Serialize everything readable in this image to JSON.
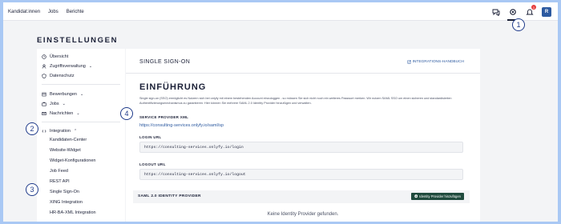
{
  "topnav": {
    "items": [
      "Kandidat:innen",
      "Jobs",
      "Berichte"
    ]
  },
  "topicons": {
    "badge": "1",
    "avatar": "R"
  },
  "page_title": "EINSTELLUNGEN",
  "sidebar": {
    "items": [
      {
        "label": "Übersicht",
        "icon": "clock-icon"
      },
      {
        "label": "Zugriffsverwaltung",
        "icon": "person-icon",
        "chevron": "⌄"
      },
      {
        "label": "Datenschutz",
        "icon": "shield-icon"
      },
      {
        "label": "Bewerbungen",
        "icon": "folder-icon",
        "chevron": "⌄"
      },
      {
        "label": "Jobs",
        "icon": "briefcase-icon",
        "chevron": "⌄"
      },
      {
        "label": "Nachrichten",
        "icon": "mail-icon",
        "chevron": "⌄"
      },
      {
        "label": "Integration",
        "icon": "code-icon",
        "chevron": "⌃"
      }
    ],
    "subitems": [
      "Kandidaten-Center",
      "Website-Widget",
      "Widget-Konfigurationen",
      "Job Feed",
      "REST API",
      "Single Sign-On",
      "XING Integration",
      "HR-BA-XML Integration"
    ]
  },
  "main": {
    "header": "SINGLE SIGN-ON",
    "handbuch_link": "INTEGRATIONS-HANDBUCH",
    "heading": "EINFÜHRUNG",
    "description": "Single sign-on (SSO) ermöglicht es Nutzern sich bei onlyfy mit einem bestehenden Account einzuloggen - so müssen Sie sich nicht noch ein weiteres Passwort merken. Wir nutzen SAML SSO um einen sicheren und standardisierten Authentifizierungsmechanismus zu garantieren. Hier können Sie mehrere SAML 2.0 Identity Provider hinzufügen und verwalten.",
    "sp_xml_label": "SERVICE PROVIDER XML",
    "sp_xml_link": "https://consulting-services.onlyfy.io/saml/sp",
    "login_label": "LOGIN URL",
    "login_value": "https://consulting-services.onlyfy.io/login",
    "logout_label": "LOGOUT URL",
    "logout_value": "https://consulting-services.onlyfy.io/logout",
    "saml_section": "SAML 2.0 IDENTITY PROVIDER",
    "add_button": "Identity Provider hinzufügen",
    "empty_text": "Keine Identity Provider gefunden."
  },
  "callouts": [
    "1",
    "2",
    "3",
    "4"
  ],
  "colors": {
    "accent_blue": "#2d5aa0",
    "button_green": "#1f4a3d",
    "callout": "#1e3a8a",
    "background": "#a9c8f4"
  }
}
